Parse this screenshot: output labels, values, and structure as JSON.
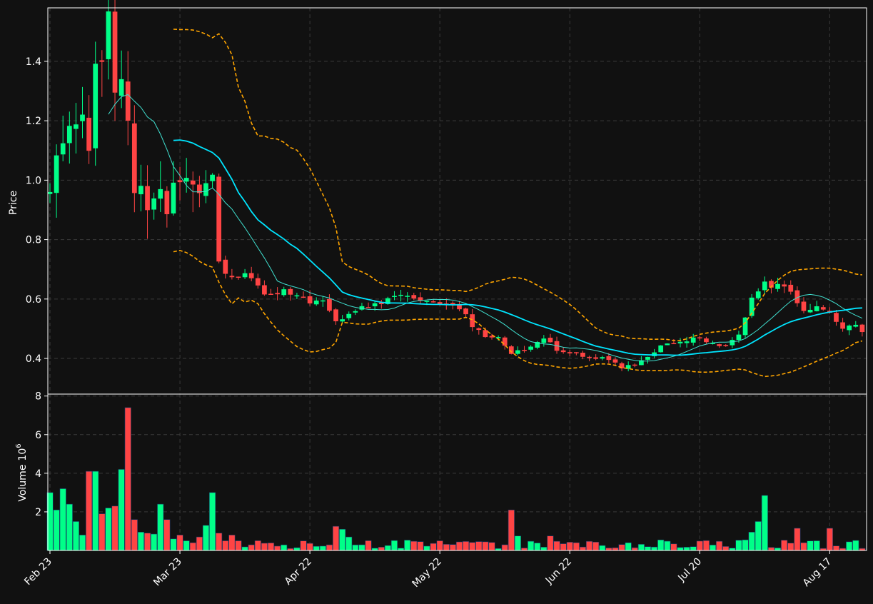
{
  "colors": {
    "background": "#111111",
    "up": "#00ff88",
    "down": "#ff4444",
    "sma_fast": "#40e0d0",
    "sma_slow": "#00e5ff",
    "bands": "#ffa500",
    "grid": "#3a3a3a",
    "axis": "#ffffff"
  },
  "chart_data": [
    {
      "type": "candlestick",
      "ylabel": "Price",
      "ylim": [
        0.28,
        1.58
      ],
      "yticks": [
        "0.4",
        "0.6",
        "0.8",
        "1.0",
        "1.2",
        "1.4"
      ],
      "grid": true,
      "overlays": [
        "moving average (fast)",
        "moving average (slow)",
        "upper band",
        "lower band"
      ]
    },
    {
      "type": "bar",
      "ylabel": "Volume",
      "ylabel_multiplier": "10",
      "ylabel_exponent": "6",
      "ylim": [
        0,
        8.1
      ],
      "yticks": [
        "2",
        "4",
        "6",
        "8"
      ],
      "grid": true
    }
  ],
  "xaxis": {
    "tick_labels": [
      "Feb 23",
      "Mar 23",
      "Apr 22",
      "May 22",
      "Jun 22",
      "Jul 20",
      "Aug 17"
    ],
    "tick_index": [
      0,
      20,
      40,
      60,
      80,
      100,
      120
    ]
  }
}
